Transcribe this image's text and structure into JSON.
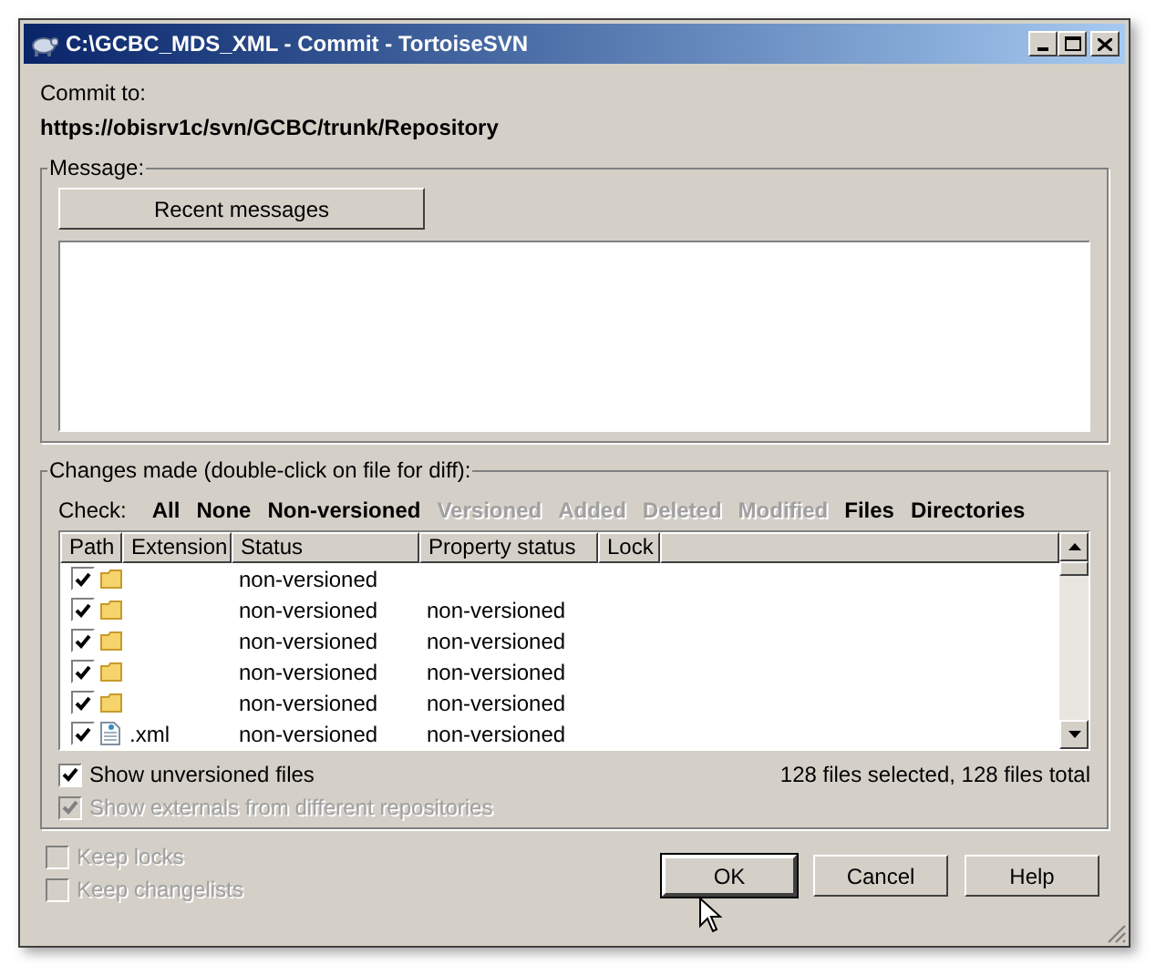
{
  "window": {
    "title": "C:\\GCBC_MDS_XML - Commit - TortoiseSVN"
  },
  "commit_to": {
    "label": "Commit to:",
    "url": "https://obisrv1c/svn/GCBC/trunk/Repository"
  },
  "message": {
    "legend": "Message:",
    "recent_button": "Recent messages"
  },
  "changes": {
    "legend": "Changes made (double-click on file for diff):",
    "check_label": "Check:",
    "check_links": [
      {
        "label": "All",
        "disabled": false
      },
      {
        "label": "None",
        "disabled": false
      },
      {
        "label": "Non-versioned",
        "disabled": false
      },
      {
        "label": "Versioned",
        "disabled": true
      },
      {
        "label": "Added",
        "disabled": true
      },
      {
        "label": "Deleted",
        "disabled": true
      },
      {
        "label": "Modified",
        "disabled": true
      },
      {
        "label": "Files",
        "disabled": false
      },
      {
        "label": "Directories",
        "disabled": false
      }
    ],
    "columns": [
      "Path",
      "Extension",
      "Status",
      "Property status",
      "Lock"
    ],
    "rows": [
      {
        "checked": true,
        "kind": "folder",
        "status": "non-versioned"
      },
      {
        "checked": true,
        "kind": "folder",
        "status": "non-versioned",
        "property_status": "non-versioned"
      },
      {
        "checked": true,
        "kind": "folder",
        "status": "non-versioned",
        "property_status": "non-versioned"
      },
      {
        "checked": true,
        "kind": "folder",
        "status": "non-versioned",
        "property_status": "non-versioned"
      },
      {
        "checked": true,
        "kind": "folder",
        "status": "non-versioned",
        "property_status": "non-versioned"
      },
      {
        "checked": true,
        "kind": "file",
        "extension": ".xml",
        "status": "non-versioned",
        "property_status": "non-versioned"
      }
    ],
    "options": [
      {
        "label": "Show unversioned files",
        "checked": true,
        "disabled": false
      },
      {
        "label": "Show externals from different repositories",
        "checked": true,
        "disabled": true
      }
    ],
    "summary": "128 files selected, 128 files total"
  },
  "bottom_options": [
    {
      "label": "Keep locks",
      "checked": false,
      "disabled": true
    },
    {
      "label": "Keep changelists",
      "checked": false,
      "disabled": true
    }
  ],
  "buttons": [
    {
      "label": "OK",
      "default": true
    },
    {
      "label": "Cancel",
      "default": false
    },
    {
      "label": "Help",
      "default": false
    }
  ]
}
